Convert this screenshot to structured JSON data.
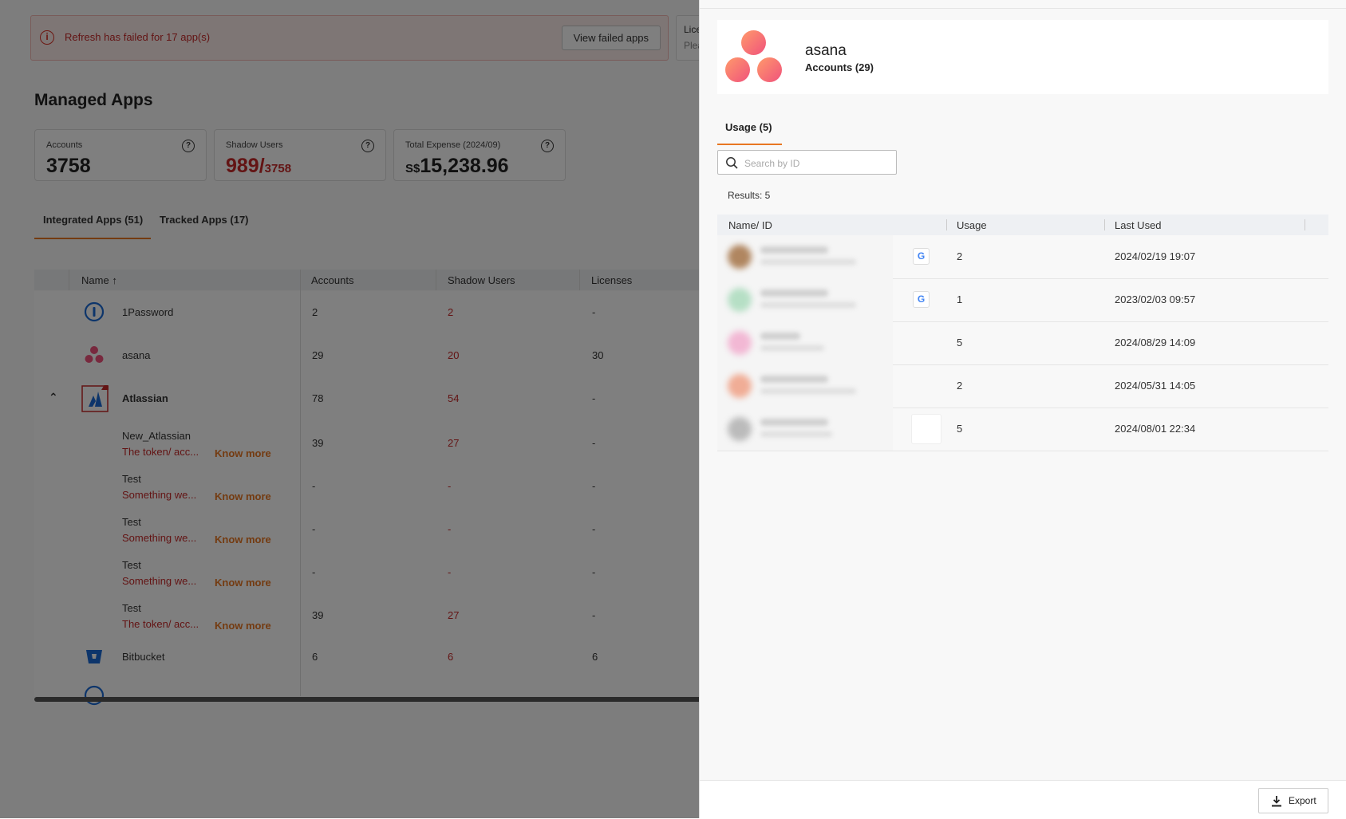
{
  "alert": {
    "message": "Refresh has failed for 17 app(s)",
    "button": "View failed apps"
  },
  "license_card": {
    "title": "Lice",
    "sub": "Plea"
  },
  "page_title": "Managed Apps",
  "stats": {
    "accounts": {
      "label": "Accounts",
      "value": "3758"
    },
    "shadow_users": {
      "label": "Shadow Users",
      "value": "989/",
      "total": "3758"
    },
    "expense": {
      "label": "Total Expense  (2024/09)",
      "currency": "S$",
      "value": "15,238.96"
    }
  },
  "tabs": [
    "Integrated Apps (51)",
    "Tracked Apps (17)"
  ],
  "table": {
    "headers": [
      "Name",
      "Accounts",
      "Shadow Users",
      "Licenses"
    ],
    "rows": [
      {
        "name": "1Password",
        "accounts": "2",
        "shadow": "2",
        "licenses": "-"
      },
      {
        "name": "asana",
        "accounts": "29",
        "shadow": "20",
        "licenses": "30"
      },
      {
        "name": "Atlassian",
        "accounts": "78",
        "shadow": "54",
        "licenses": "-"
      },
      {
        "name": "New_Atlassian",
        "error": "The token/ acc...",
        "link": "Know more",
        "accounts": "39",
        "shadow": "27",
        "licenses": "-"
      },
      {
        "name": "Test",
        "error": "Something we...",
        "link": "Know more",
        "accounts": "-",
        "shadow": "-",
        "licenses": "-"
      },
      {
        "name": "Test",
        "error": "Something we...",
        "link": "Know more",
        "accounts": "-",
        "shadow": "-",
        "licenses": "-"
      },
      {
        "name": "Test",
        "error": "Something we...",
        "link": "Know more",
        "accounts": "-",
        "shadow": "-",
        "licenses": "-"
      },
      {
        "name": "Test",
        "error": "The token/ acc...",
        "link": "Know more",
        "accounts": "39",
        "shadow": "27",
        "licenses": "-"
      },
      {
        "name": "Bitbucket",
        "accounts": "6",
        "shadow": "6",
        "licenses": "6"
      }
    ]
  },
  "drawer": {
    "app_name": "asana",
    "accounts": "Accounts (29)",
    "tab": "Usage (5)",
    "search_placeholder": "Search by ID",
    "results": "Results: 5",
    "headers": [
      "Name/ ID",
      "Usage",
      "Last Used"
    ],
    "rows": [
      {
        "google": true,
        "usage": "2",
        "last_used": "2024/02/19 19:07"
      },
      {
        "google": true,
        "usage": "1",
        "last_used": "2023/02/03 09:57"
      },
      {
        "google": false,
        "usage": "5",
        "last_used": "2024/08/29 14:09"
      },
      {
        "google": false,
        "usage": "2",
        "last_used": "2024/05/31 14:05"
      },
      {
        "google": false,
        "usage": "5",
        "last_used": "2024/08/01 22:34"
      }
    ],
    "export_label": "Export"
  },
  "colors": {
    "accent": "#e87722",
    "error": "#c62828",
    "asana": "#f0527c"
  }
}
